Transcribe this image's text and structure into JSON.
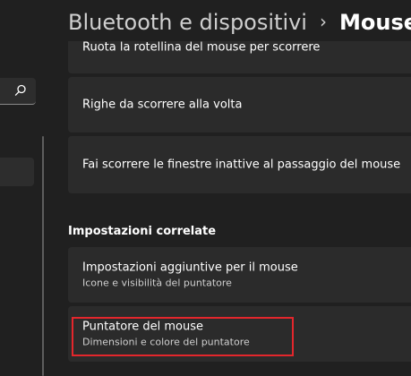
{
  "header": {
    "parent": "Bluetooth e dispositivi",
    "separator": "›",
    "current": "Mouse"
  },
  "nav": {
    "search_icon": "search-icon"
  },
  "settings": [
    {
      "title": "Ruota la rotellina del mouse per scorrere"
    },
    {
      "title": "Righe da scorrere alla volta"
    },
    {
      "title": "Fai scorrere le finestre inattive al passaggio del mouse"
    }
  ],
  "related": {
    "section_title": "Impostazioni correlate",
    "items": [
      {
        "title": "Impostazioni aggiuntive per il mouse",
        "subtitle": "Icone e visibilità del puntatore"
      },
      {
        "title": "Puntatore del mouse",
        "subtitle": "Dimensioni e colore del puntatore"
      }
    ]
  },
  "colors": {
    "background": "#202020",
    "card": "#2b2b2b",
    "highlight": "#e3262c"
  }
}
